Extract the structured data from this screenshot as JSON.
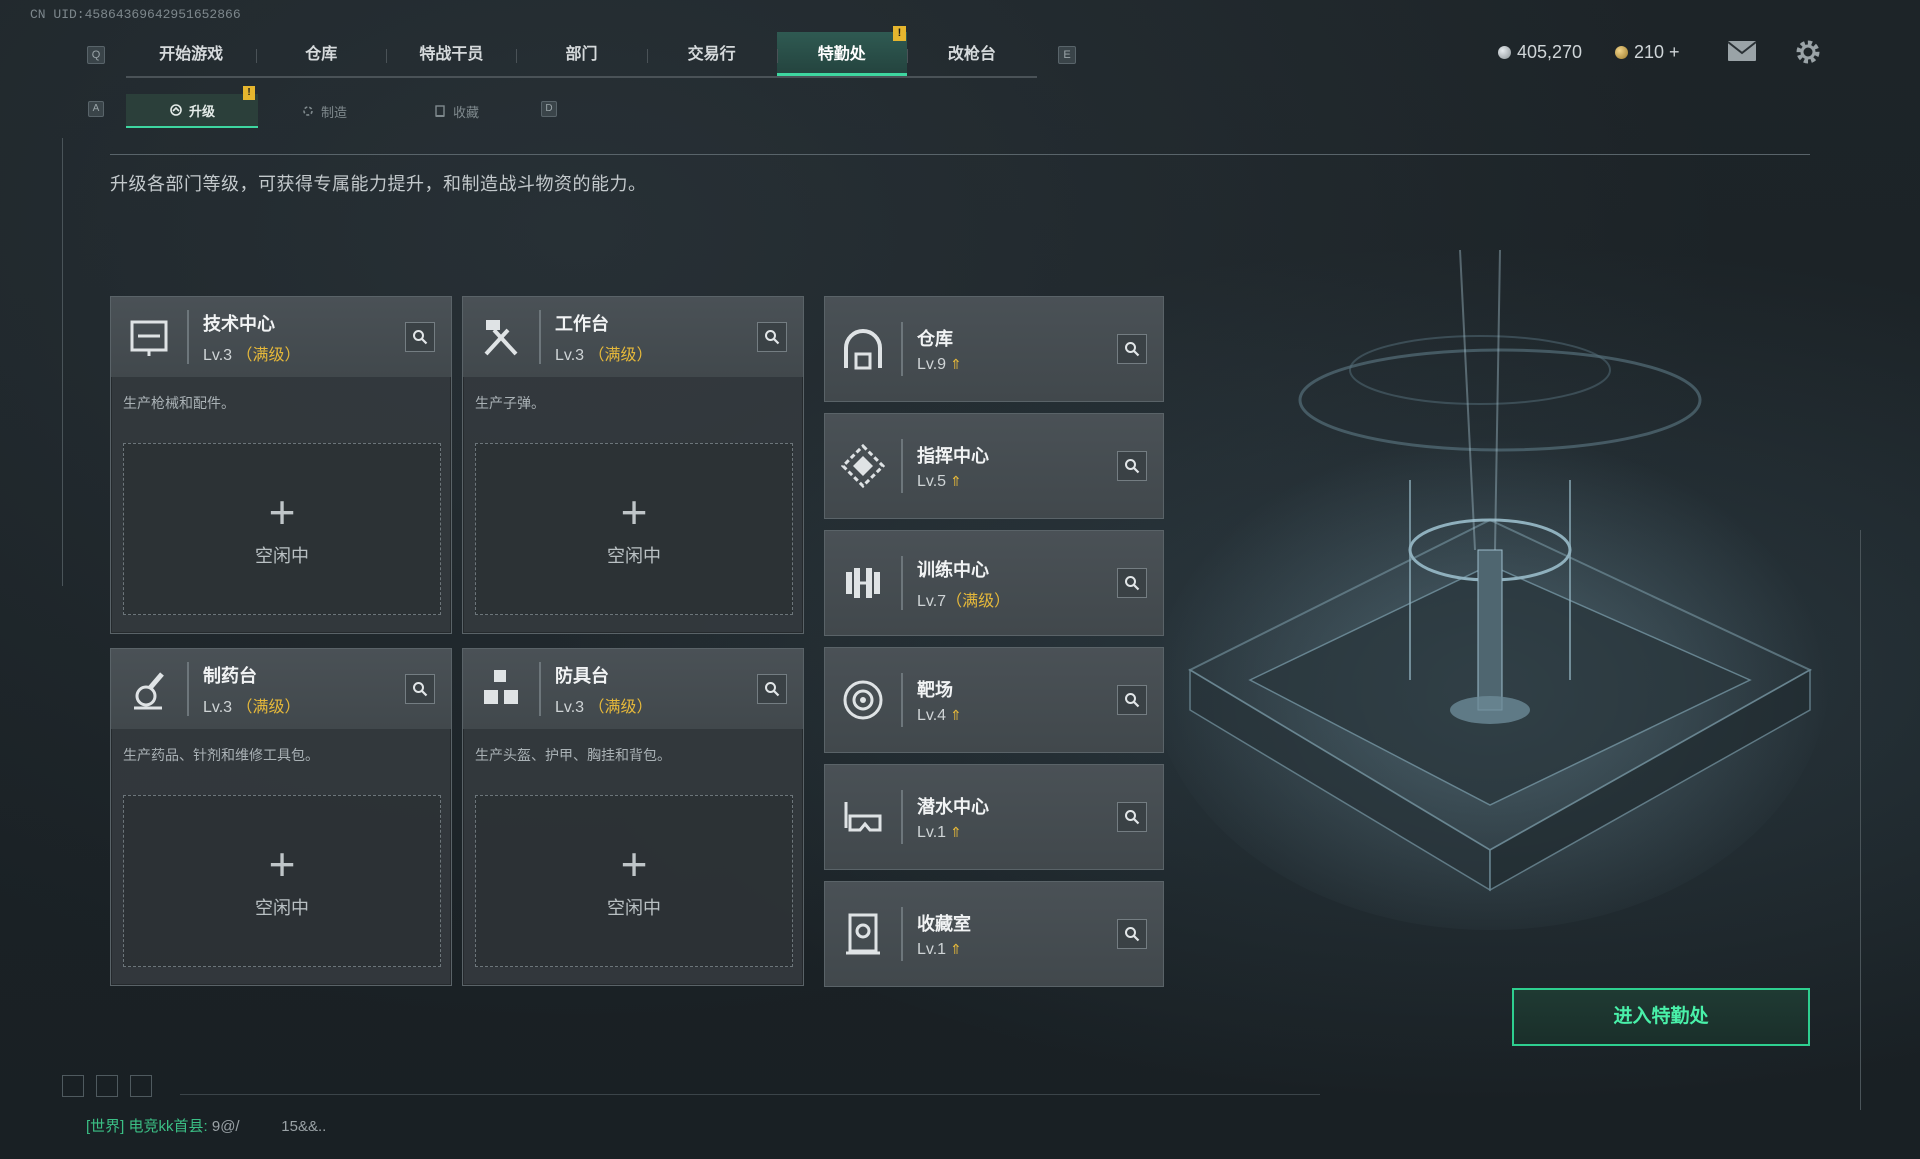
{
  "uid": "CN UID:4586436964295165286​6",
  "keyhints": {
    "left": "Q",
    "right": "E",
    "sub_left": "A",
    "sub_right": "D"
  },
  "nav": {
    "tabs": [
      "开始游戏",
      "仓库",
      "特战干员",
      "部门",
      "交易行",
      "特勤处",
      "改枪台"
    ],
    "active": "特勤处",
    "badge": "!"
  },
  "currency": {
    "silver": "405,270",
    "gold": "210 +",
    "silver_color": "#b7bec2",
    "gold_color": "#d2a94a"
  },
  "icons": {
    "mail": "mail-icon",
    "settings": "gear-icon"
  },
  "subtabs": [
    {
      "label": "升级",
      "icon": "upgrade-icon"
    },
    {
      "label": "制造",
      "icon": "craft-icon"
    },
    {
      "label": "收藏",
      "icon": "collection-icon"
    }
  ],
  "subtab_badge": "!",
  "description": "升级各部门等级，可获得专属能力提升，和制造战斗物资的能力。",
  "production_cards": [
    {
      "title": "技术中心",
      "level": "Lv.3",
      "max": "（满级）",
      "desc": "生产枪械和配件。",
      "idle": "空闲中",
      "icon": "tech-center-icon"
    },
    {
      "title": "工作台",
      "level": "Lv.3",
      "max": "（满级）",
      "desc": "生产子弹。",
      "idle": "空闲中",
      "icon": "workbench-icon"
    },
    {
      "title": "制药台",
      "level": "Lv.3",
      "max": "（满级）",
      "desc": "生产药品、针剂和维修工具包。",
      "idle": "空闲中",
      "icon": "pharmacy-icon"
    },
    {
      "title": "防具台",
      "level": "Lv.3",
      "max": "（满级）",
      "desc": "生产头盔、护甲、胸挂和背包。",
      "idle": "空闲中",
      "icon": "armor-bench-icon"
    }
  ],
  "facility_cards": [
    {
      "title": "仓库",
      "level": "Lv.9",
      "max": "",
      "upgradable": true,
      "icon": "warehouse-icon"
    },
    {
      "title": "指挥中心",
      "level": "Lv.5",
      "max": "",
      "upgradable": true,
      "icon": "command-center-icon"
    },
    {
      "title": "训练中心",
      "level": "Lv.7",
      "max": "（满级）",
      "upgradable": false,
      "icon": "training-center-icon"
    },
    {
      "title": "靶场",
      "level": "Lv.4",
      "max": "",
      "upgradable": true,
      "icon": "shooting-range-icon"
    },
    {
      "title": "潜水中心",
      "level": "Lv.1",
      "max": "",
      "upgradable": true,
      "icon": "diving-center-icon"
    },
    {
      "title": "收藏室",
      "level": "Lv.1",
      "max": "",
      "upgradable": true,
      "icon": "collection-room-icon"
    }
  ],
  "enter_button": "进入特勤处",
  "chat": {
    "channel": "[世界]",
    "name": "电竞kk首县:",
    "message": "9@/          15&&.."
  },
  "accent": "#3ed6a0",
  "max_color": "#e5b83a"
}
